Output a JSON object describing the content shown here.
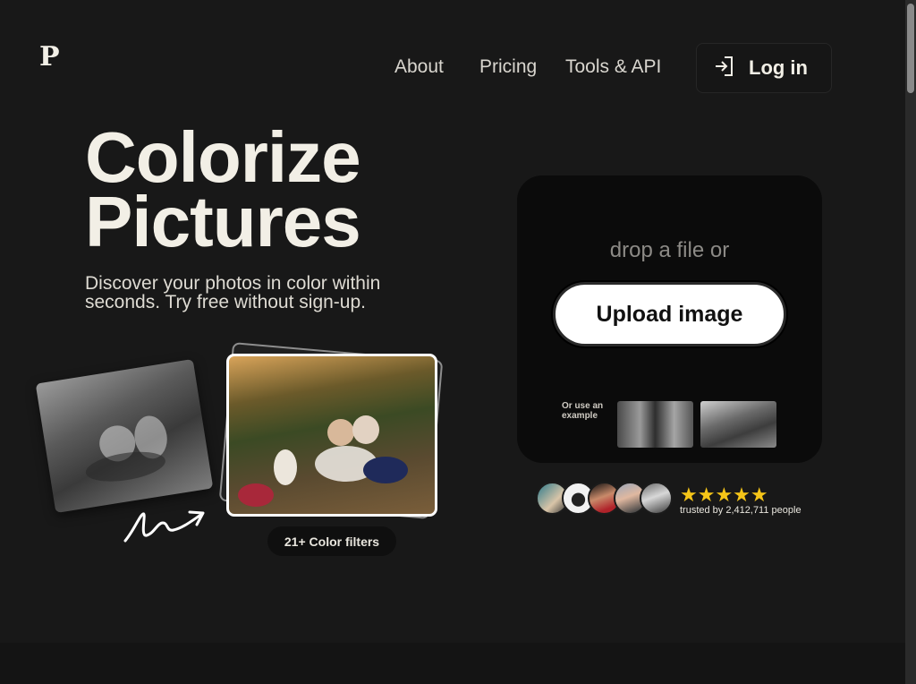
{
  "logo": {
    "text": "P"
  },
  "nav": {
    "items": [
      {
        "label": "About"
      },
      {
        "label": "Pricing"
      },
      {
        "label": "Tools & API"
      }
    ],
    "login": {
      "label": "Log in",
      "icon": "login-icon"
    }
  },
  "hero": {
    "title_line1": "Colorize",
    "title_line2": "Pictures",
    "subtitle": "Discover your photos in color within seconds. Try free without sign-up."
  },
  "filters_badge": "21+ Color filters",
  "upload": {
    "drop_text": "drop a file or",
    "button_label": "Upload image",
    "example_label": "Or use an example"
  },
  "trust": {
    "stars": "★★★★★",
    "text": "trusted by 2,412,711 people"
  },
  "colors": {
    "background": "#181818",
    "text": "#f2efe6",
    "card": "#0b0b0b",
    "star": "#f5c518"
  }
}
